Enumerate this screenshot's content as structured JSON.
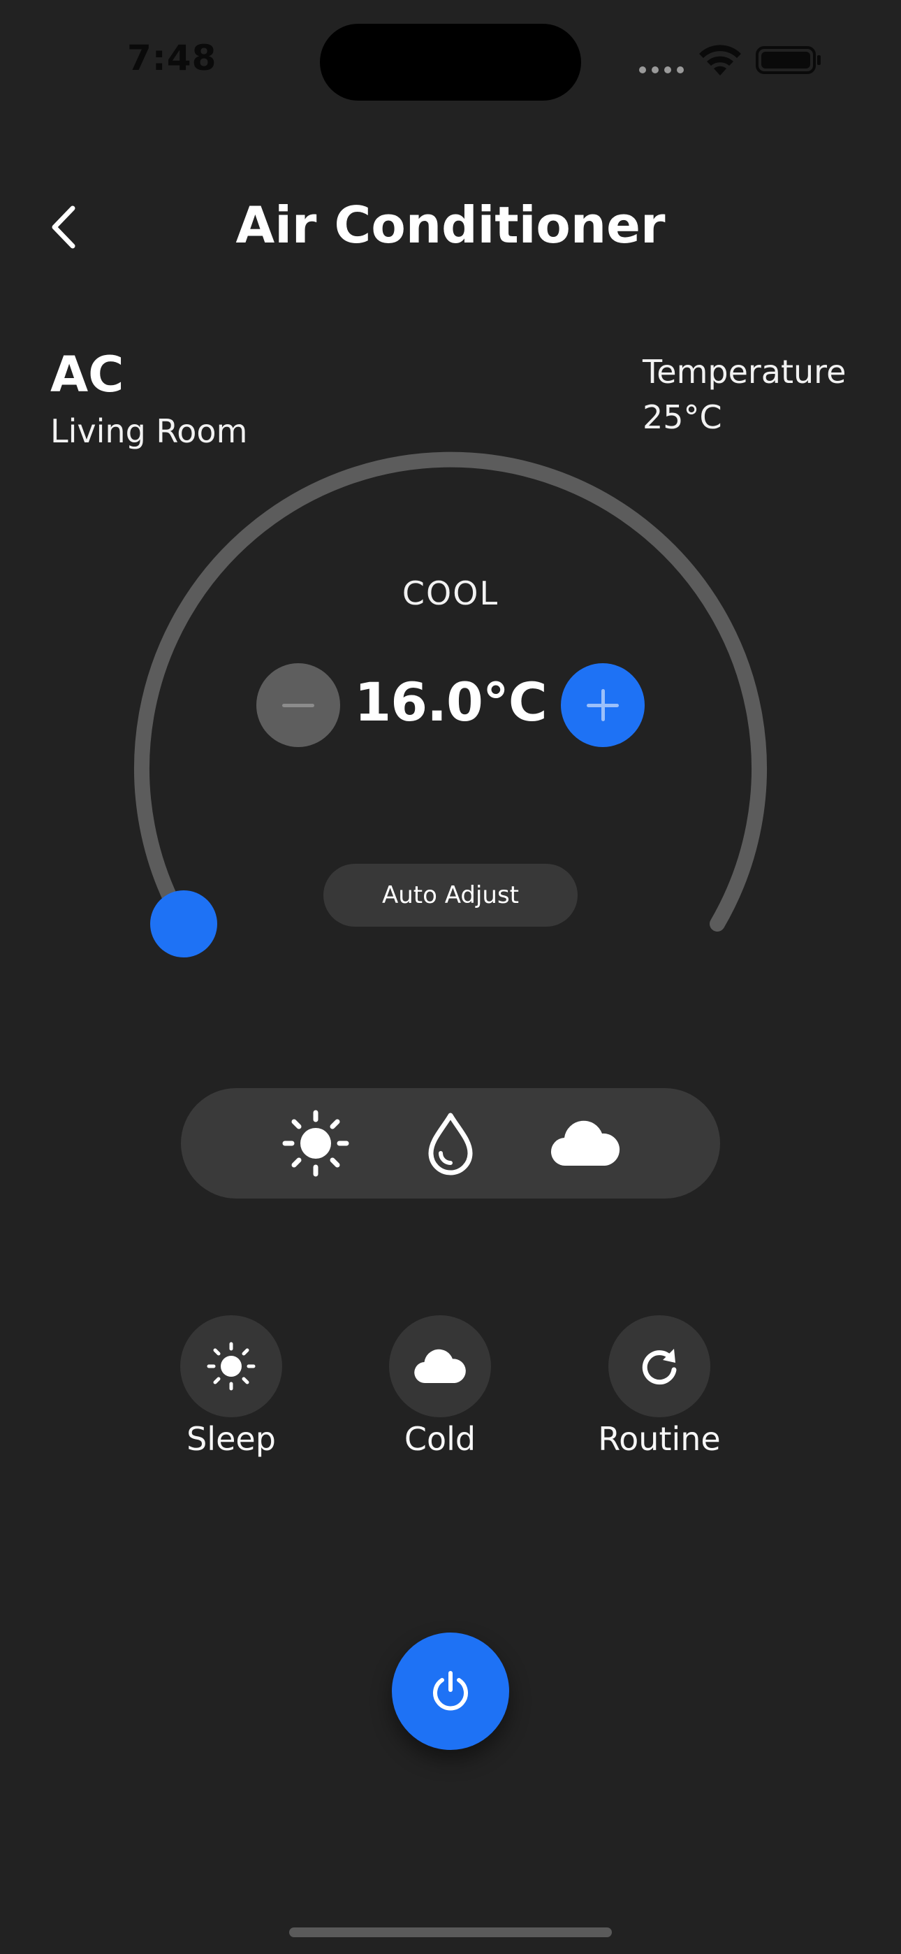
{
  "status_bar": {
    "time": "7:48"
  },
  "header": {
    "title": "Air Conditioner",
    "back_icon": "chevron-left-icon"
  },
  "device": {
    "name": "AC",
    "room": "Living Room",
    "temperature_label": "Temperature",
    "temperature_value": "25°C"
  },
  "dial": {
    "mode": "COOL",
    "setpoint": "16.0°C",
    "dial_level": 0.0,
    "auto_adjust_label": "Auto Adjust",
    "colors": {
      "track": "#5c5c5c",
      "accent": "#1e72f5"
    }
  },
  "mode_bar": {
    "items": [
      {
        "icon": "sun-icon"
      },
      {
        "icon": "water-drop-icon"
      },
      {
        "icon": "cloud-icon"
      }
    ]
  },
  "quick_actions": [
    {
      "label": "Sleep",
      "icon": "sun-icon"
    },
    {
      "label": "Cold",
      "icon": "cloud-icon"
    },
    {
      "label": "Routine",
      "icon": "refresh-icon"
    }
  ],
  "power": {
    "icon": "power-icon"
  }
}
